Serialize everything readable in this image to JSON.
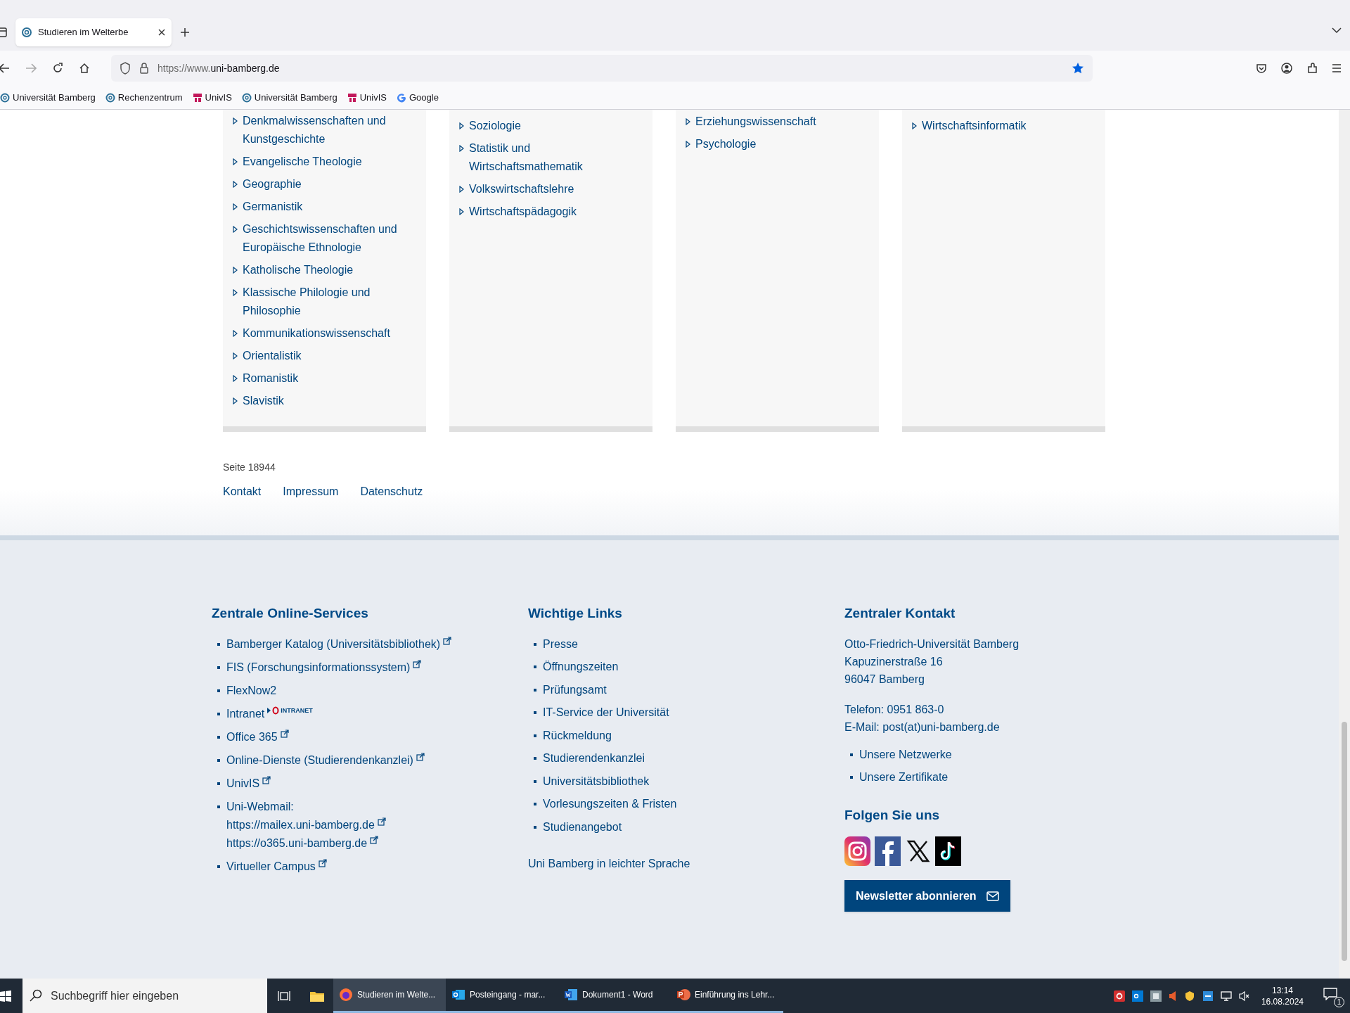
{
  "browser": {
    "tabs": [
      {
        "title": "Studieren im Welterbe",
        "selected": true
      }
    ],
    "url_prefix": "https://www.",
    "url_domain": "uni-bamberg.de",
    "bookmarked": true,
    "bookmarks": [
      {
        "label": "Universität Bamberg",
        "kind": "uni"
      },
      {
        "label": "Rechenzentrum",
        "kind": "uni"
      },
      {
        "label": "UnivIS",
        "kind": "univis"
      },
      {
        "label": "Universität Bamberg",
        "kind": "uni"
      },
      {
        "label": "UnivIS",
        "kind": "univis"
      },
      {
        "label": "Google",
        "kind": "google"
      }
    ]
  },
  "content": {
    "columns": [
      {
        "items": [
          "Denkmalwissenschaften und Kunstgeschichte",
          "Evangelische Theologie",
          "Geographie",
          "Germanistik",
          "Geschichtswissenschaften und Europäische Ethnologie",
          "Katholische Theologie",
          "Klassische Philologie und Philosophie",
          "Kommunikationswissenschaft",
          "Orientalistik",
          "Romanistik",
          "Slavistik"
        ]
      },
      {
        "items": [
          "Soziologie",
          "Statistik und Wirtschaftsmathematik",
          "Volkswirtschaftslehre",
          "Wirtschaftspädagogik"
        ]
      },
      {
        "items": [
          "Erziehungswissenschaft",
          "Psychologie"
        ]
      },
      {
        "items": [
          "Wirtschaftsinformatik"
        ]
      }
    ]
  },
  "page_footer": {
    "page_number": "Seite 18944",
    "links": [
      "Kontakt",
      "Impressum",
      "Datenschutz"
    ]
  },
  "footer": {
    "services": {
      "heading": "Zentrale Online-Services",
      "items": [
        {
          "lines": [
            {
              "text": "Bamberger Katalog (Universitätsbibliothek)",
              "external": true
            }
          ]
        },
        {
          "lines": [
            {
              "text": "FIS (Forschungsinformationssystem)",
              "external": true
            }
          ]
        },
        {
          "lines": [
            {
              "text": "FlexNow2",
              "external": false
            }
          ]
        },
        {
          "lines": [
            {
              "text": "Intranet",
              "external": false,
              "logo": "INTRANET"
            }
          ]
        },
        {
          "lines": [
            {
              "text": "Office 365",
              "external": true
            }
          ]
        },
        {
          "lines": [
            {
              "text": "Online-Dienste (Studierendenkanzlei)",
              "external": true
            }
          ]
        },
        {
          "lines": [
            {
              "text": "UnivIS",
              "external": true
            }
          ]
        },
        {
          "lines": [
            {
              "text": "Uni-Webmail:",
              "external": false
            },
            {
              "text": "https://mailex.uni-bamberg.de",
              "external": true
            },
            {
              "text": "https://o365.uni-bamberg.de",
              "external": true
            }
          ]
        },
        {
          "lines": [
            {
              "text": "Virtueller Campus",
              "external": true
            }
          ]
        }
      ]
    },
    "links": {
      "heading": "Wichtige Links",
      "items": [
        "Presse",
        "Öffnungszeiten",
        "Prüfungsamt",
        "IT-Service der Universität",
        "Rückmeldung",
        "Studierendenkanzlei",
        "Universitätsbibliothek",
        "Vorlesungszeiten & Fristen",
        "Studienangebot"
      ],
      "extra": "Uni Bamberg in leichter Sprache"
    },
    "contact": {
      "heading": "Zentraler Kontakt",
      "address": [
        "Otto-Friedrich-Universität Bamberg",
        "Kapuzinerstraße 16",
        "96047 Bamberg"
      ],
      "phone": "Telefon: 0951 863-0",
      "email": "E-Mail: post(at)uni-bamberg.de",
      "items": [
        "Unsere Netzwerke",
        "Unsere Zertifikate"
      ],
      "follow_heading": "Folgen Sie uns",
      "newsletter": "Newsletter abonnieren"
    }
  },
  "taskbar": {
    "search_placeholder": "Suchbegriff hier eingeben",
    "apps": [
      {
        "label": "Studieren im Welte...",
        "kind": "firefox",
        "selected": true
      },
      {
        "label": "Posteingang - mar...",
        "kind": "outlook",
        "selected": false
      },
      {
        "label": "Dokument1 - Word",
        "kind": "word",
        "selected": false
      },
      {
        "label": "Einführung ins Lehr...",
        "kind": "powerpoint",
        "selected": false
      }
    ],
    "time": "13:14",
    "date": "16.08.2024",
    "notifications": "1"
  }
}
